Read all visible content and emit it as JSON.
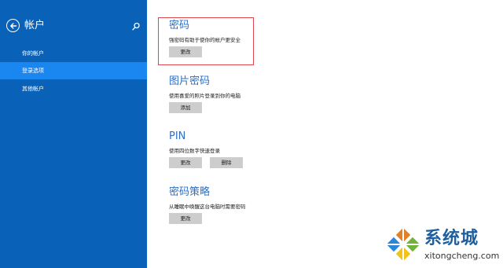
{
  "colors": {
    "sidebar_bg": "#0a62b8",
    "nav_active": "#1a87f0",
    "accent": "#2f6fc0",
    "button_bg": "#cdcdcd",
    "highlight_border": "#e0484d"
  },
  "sidebar": {
    "title": "帐户",
    "back_icon": "back-arrow-icon",
    "search_icon": "search-icon",
    "items": [
      {
        "label": "你的帐户",
        "active": false
      },
      {
        "label": "登录选项",
        "active": true
      },
      {
        "label": "其他帐户",
        "active": false
      }
    ]
  },
  "main": {
    "password": {
      "title": "密码",
      "description": "强密码有助于使你的帐户更安全",
      "change_label": "更改"
    },
    "picture_password": {
      "title": "图片密码",
      "description": "使用喜爱的照片登录到你的电脑",
      "add_label": "添加"
    },
    "pin": {
      "title": "PIN",
      "description": "使用四位数字快速登录",
      "change_label": "更改",
      "remove_label": "删除"
    },
    "password_policy": {
      "title": "密码策略",
      "description": "从睡眠中唤醒这台电脑时需要密码",
      "change_label": "更改"
    }
  },
  "watermark": {
    "name": "系统城",
    "url": "xitongcheng.com"
  }
}
